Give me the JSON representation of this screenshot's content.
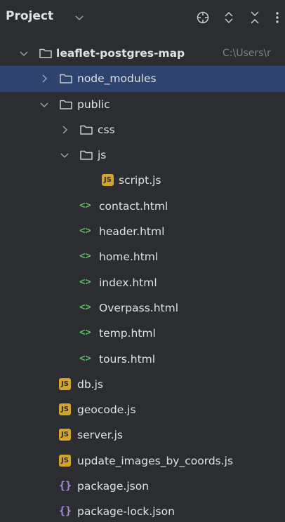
{
  "header": {
    "title": "Project",
    "icons": [
      "crosshair-icon",
      "expand-all-icon",
      "collapse-all-icon",
      "more-icon"
    ]
  },
  "tree": {
    "root": {
      "label": "leaflet-postgres-map",
      "path": "C:\\Users\\r",
      "expanded": true
    },
    "node_modules": {
      "label": "node_modules",
      "expanded": false,
      "selected": true
    },
    "public": {
      "label": "public",
      "expanded": true
    },
    "css": {
      "label": "css",
      "expanded": false
    },
    "js": {
      "label": "js",
      "expanded": true
    },
    "script_js": {
      "label": "script.js"
    },
    "contact_html": {
      "label": "contact.html"
    },
    "header_html": {
      "label": "header.html"
    },
    "home_html": {
      "label": "home.html"
    },
    "index_html": {
      "label": "index.html"
    },
    "overpass_html": {
      "label": "Overpass.html"
    },
    "temp_html": {
      "label": "temp.html"
    },
    "tours_html": {
      "label": "tours.html"
    },
    "db_js": {
      "label": "db.js"
    },
    "geocode_js": {
      "label": "geocode.js"
    },
    "server_js": {
      "label": "server.js"
    },
    "update_js": {
      "label": "update_images_by_coords.js"
    },
    "package_json": {
      "label": "package.json"
    },
    "package_lock_json": {
      "label": "package-lock.json"
    }
  },
  "badges": {
    "js": "JS",
    "html": "<>",
    "json": "{}"
  },
  "colors": {
    "background": "#2b2d30",
    "selection": "#2e436e",
    "text": "#dfe1e5",
    "muted": "#7f8287",
    "js_badge": "#d3a52f",
    "html_icon": "#5fb865",
    "json_icon": "#a88bd8"
  }
}
